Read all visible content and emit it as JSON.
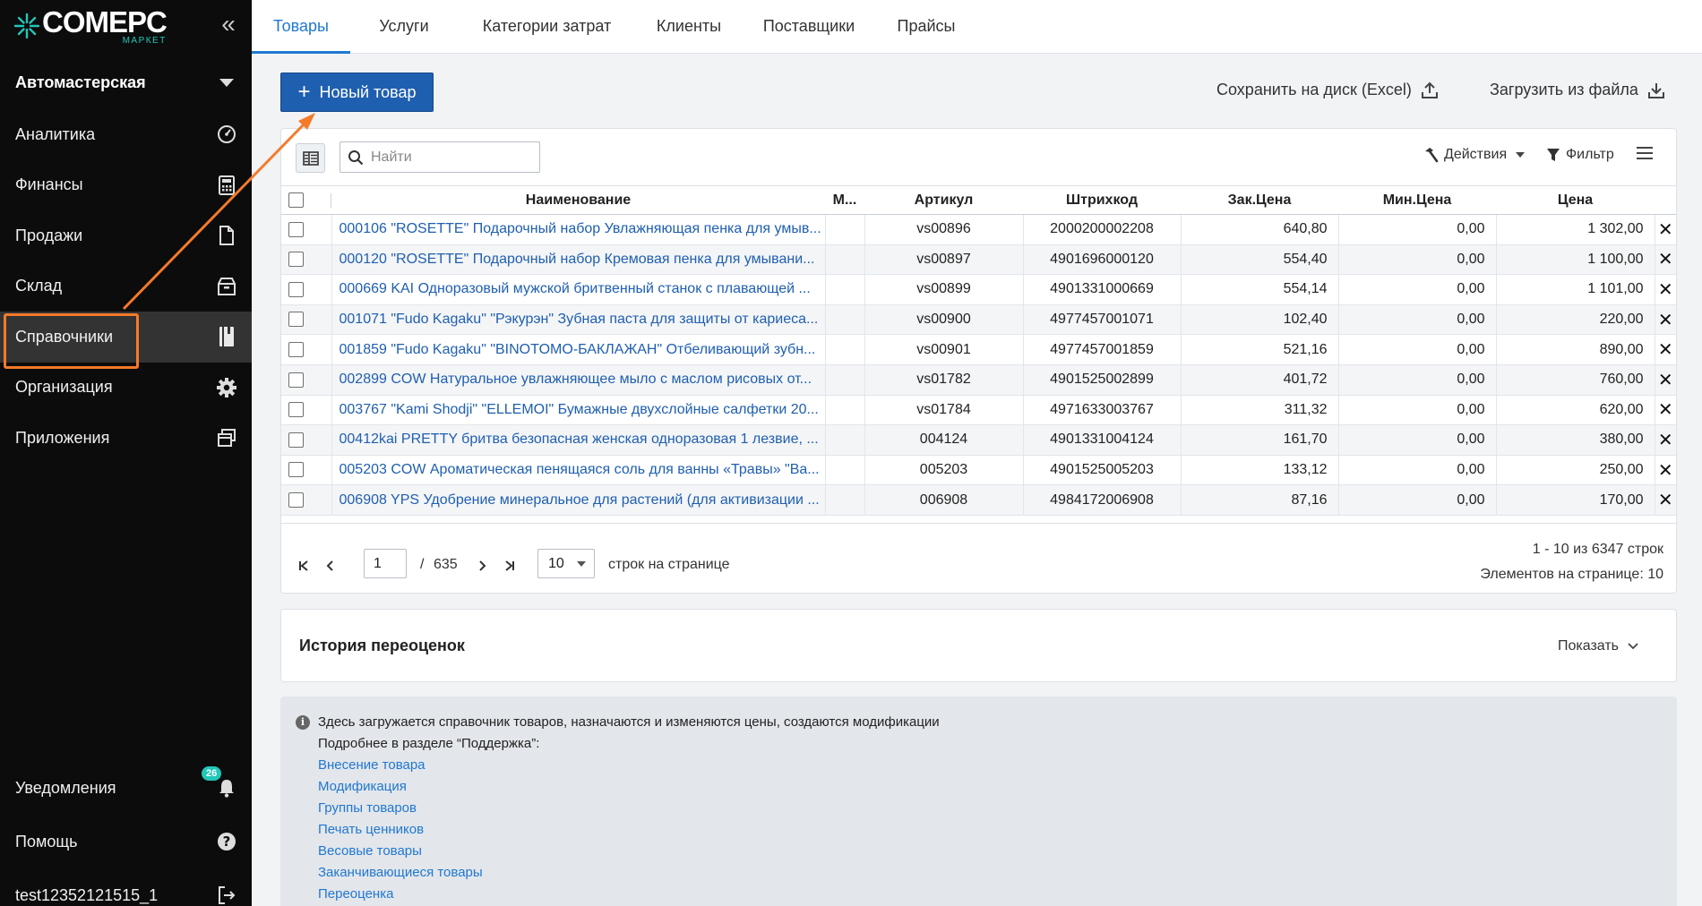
{
  "brand": {
    "name": "COMEPC",
    "sub": "МАРКЕТ",
    "accent": "#21c7b8"
  },
  "sidebar": {
    "org": "Автомастерская",
    "items": [
      {
        "label": "Аналитика",
        "icon": "gauge-icon"
      },
      {
        "label": "Финансы",
        "icon": "calculator-icon"
      },
      {
        "label": "Продажи",
        "icon": "document-icon"
      },
      {
        "label": "Склад",
        "icon": "box-icon"
      },
      {
        "label": "Справочники",
        "icon": "book-icon",
        "active": true
      },
      {
        "label": "Организация",
        "icon": "gear-icon"
      },
      {
        "label": "Приложения",
        "icon": "windows-icon"
      }
    ],
    "notifications": {
      "label": "Уведомления",
      "count": "26"
    },
    "help": "Помощь",
    "user": "test12352121515_1"
  },
  "tabs": [
    "Товары",
    "Услуги",
    "Категории затрат",
    "Клиенты",
    "Поставщики",
    "Прайсы"
  ],
  "actions": {
    "new_item": "Новый товар",
    "save_excel": "Сохранить на диск (Excel)",
    "upload": "Загрузить из файла"
  },
  "toolbar": {
    "search_placeholder": "Найти",
    "actions": "Действия",
    "filter": "Фильтр"
  },
  "table": {
    "columns": [
      "Наименование",
      "М...",
      "Артикул",
      "Штрихкод",
      "Зак.Цена",
      "Мин.Цена",
      "Цена"
    ],
    "rows": [
      [
        "000106 \"ROSETTE\" Подарочный набор Увлажняющая пенка для умыв...",
        "",
        "vs00896",
        "2000200002208",
        "640,80",
        "0,00",
        "1 302,00"
      ],
      [
        "000120 \"ROSETTE\" Подарочный набор Кремовая пенка для умывани...",
        "",
        "vs00897",
        "4901696000120",
        "554,40",
        "0,00",
        "1 100,00"
      ],
      [
        "000669 KAI Одноразовый мужской бритвенный станок с плавающей ...",
        "",
        "vs00899",
        "4901331000669",
        "554,14",
        "0,00",
        "1 101,00"
      ],
      [
        "001071 \"Fudo Kagaku\" \"Рэкурэн\" Зубная паста для защиты от кариеса...",
        "",
        "vs00900",
        "4977457001071",
        "102,40",
        "0,00",
        "220,00"
      ],
      [
        "001859 \"Fudo Kagaku\" \"BINOTOMO-БАКЛАЖАН\" Отбеливающий зубн...",
        "",
        "vs00901",
        "4977457001859",
        "521,16",
        "0,00",
        "890,00"
      ],
      [
        "002899 COW Натуральное увлажняющее мыло с маслом рисовых от...",
        "",
        "vs01782",
        "4901525002899",
        "401,72",
        "0,00",
        "760,00"
      ],
      [
        "003767 \"Kami Shodji\" \"ELLEMOI\" Бумажные двухслойные салфетки 20...",
        "",
        "vs01784",
        "4971633003767",
        "311,32",
        "0,00",
        "620,00"
      ],
      [
        "00412kai PRETTY бритва безопасная женская одноразовая 1 лезвие, ...",
        "",
        "004124",
        "4901331004124",
        "161,70",
        "0,00",
        "380,00"
      ],
      [
        "005203 COW Ароматическая пенящаяся соль для ванны «Травы» \"Ва...",
        "",
        "005203",
        "4901525005203",
        "133,12",
        "0,00",
        "250,00"
      ],
      [
        "006908 YPS Удобрение минеральное для растений (для активизации ...",
        "",
        "006908",
        "4984172006908",
        "87,16",
        "0,00",
        "170,00"
      ]
    ]
  },
  "pager": {
    "page": "1",
    "sep": "/",
    "total_pages": "635",
    "per_page": "10",
    "per_page_label": "строк на странице",
    "range": "1 - 10 из 6347 строк",
    "elements": "Элементов на странице: 10"
  },
  "history": {
    "title": "История переоценок",
    "show": "Показать"
  },
  "info": {
    "line1": "Здесь загружается справочник товаров, назначаются и изменяются цены, создаются модификации",
    "line2": "Подробнее в разделе “Поддержка”:",
    "links": [
      "Внесение товара",
      "Модификация",
      "Группы товаров",
      "Печать ценников",
      "Весовые товары",
      "Заканчивающиеся товары",
      "Переоценка"
    ]
  },
  "colors": {
    "primary": "#1f5fb0",
    "link": "#1f78d1",
    "highlight": "#f57a2a"
  }
}
